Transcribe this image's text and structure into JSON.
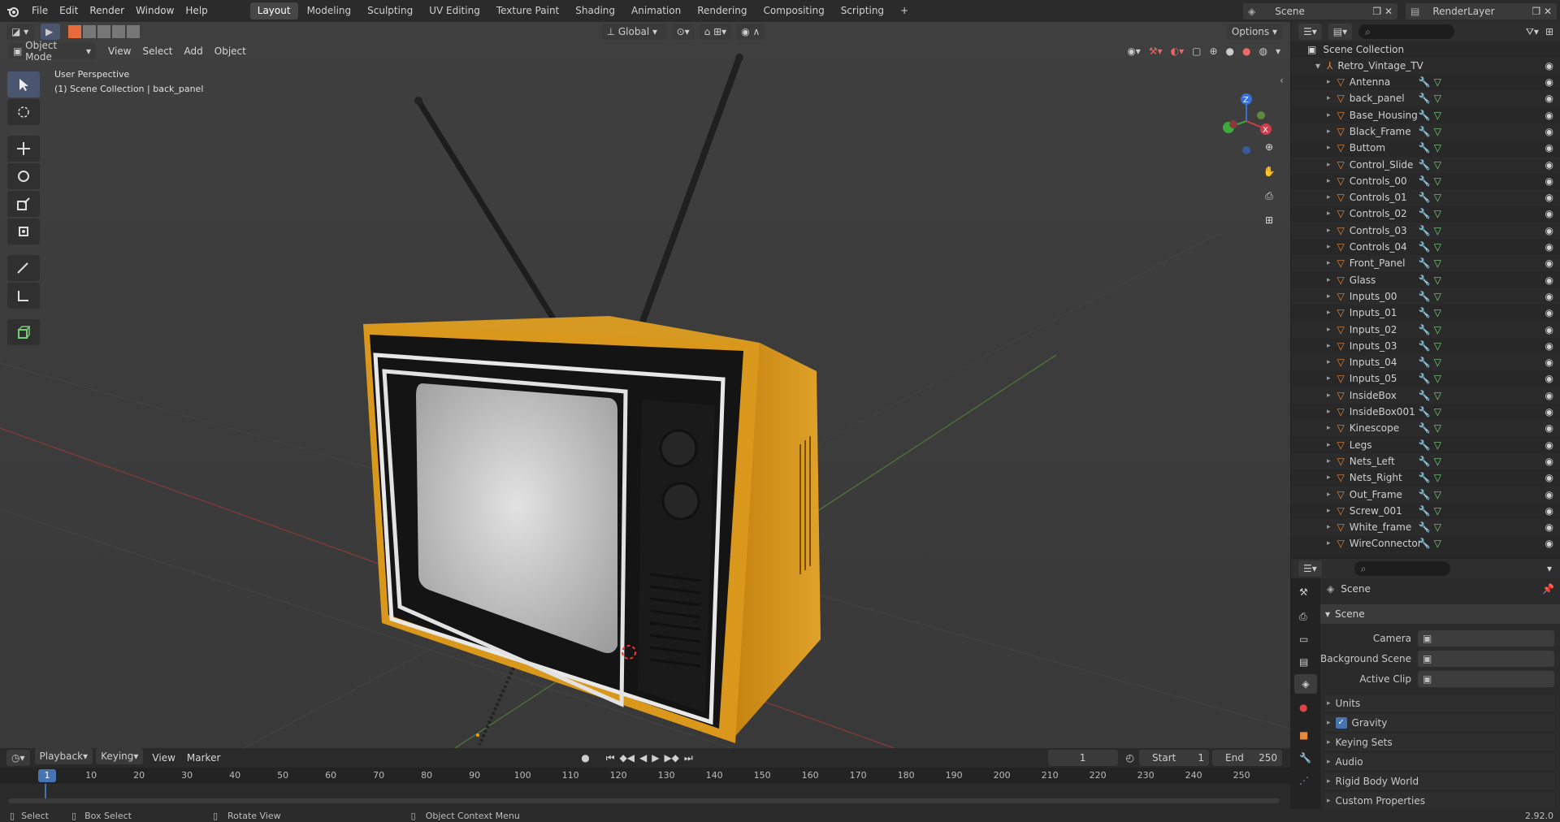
{
  "topbar": {
    "menus": [
      "File",
      "Edit",
      "Render",
      "Window",
      "Help"
    ],
    "workspaces": [
      "Layout",
      "Modeling",
      "Sculpting",
      "UV Editing",
      "Texture Paint",
      "Shading",
      "Animation",
      "Rendering",
      "Compositing",
      "Scripting"
    ],
    "active_workspace": "Layout",
    "add_tab": "+",
    "scene_name": "Scene",
    "render_layer": "RenderLayer"
  },
  "viewport_header": {
    "mode": "Object Mode",
    "menus": [
      "View",
      "Select",
      "Add",
      "Object"
    ],
    "orientation": "Global",
    "options": "Options"
  },
  "viewport": {
    "perspective_label": "User Perspective",
    "collection_label": "(1) Scene Collection | back_panel",
    "gizmo_axes": [
      "Z",
      "Y",
      "X"
    ]
  },
  "outliner": {
    "root": "Scene Collection",
    "collection": "Retro_Vintage_TV",
    "objects": [
      "Antenna",
      "back_panel",
      "Base_Housing",
      "Black_Frame",
      "Buttom",
      "Control_Slide",
      "Controls_00",
      "Controls_01",
      "Controls_02",
      "Controls_03",
      "Controls_04",
      "Front_Panel",
      "Glass",
      "Inputs_00",
      "Inputs_01",
      "Inputs_02",
      "Inputs_03",
      "Inputs_04",
      "Inputs_05",
      "InsideBox",
      "InsideBox001",
      "Kinescope",
      "Legs",
      "Nets_Left",
      "Nets_Right",
      "Out_Frame",
      "Screw_001",
      "White_frame",
      "WireConnector"
    ]
  },
  "properties": {
    "context": "Scene",
    "panel": "Scene",
    "fields": [
      {
        "label": "Camera",
        "value": ""
      },
      {
        "label": "Background Scene",
        "value": ""
      },
      {
        "label": "Active Clip",
        "value": ""
      }
    ],
    "sections": [
      {
        "label": "Units",
        "checkbox": false
      },
      {
        "label": "Gravity",
        "checkbox": true
      },
      {
        "label": "Keying Sets",
        "checkbox": false
      },
      {
        "label": "Audio",
        "checkbox": false
      },
      {
        "label": "Rigid Body World",
        "checkbox": false
      },
      {
        "label": "Custom Properties",
        "checkbox": false
      }
    ]
  },
  "timeline": {
    "menus": [
      "Playback",
      "Keying",
      "View",
      "Marker"
    ],
    "current_frame": "1",
    "start_label": "Start",
    "start": "1",
    "end_label": "End",
    "end": "250",
    "ruler": [
      "1",
      "10",
      "20",
      "30",
      "40",
      "50",
      "60",
      "70",
      "80",
      "90",
      "100",
      "110",
      "120",
      "130",
      "140",
      "150",
      "160",
      "170",
      "180",
      "190",
      "200",
      "210",
      "220",
      "230",
      "240",
      "250"
    ]
  },
  "statusbar": {
    "items": [
      "Select",
      "Box Select",
      "Rotate View",
      "Object Context Menu"
    ],
    "version": "2.92.0"
  },
  "colors": {
    "accent": "#4772b3",
    "tv_orange": "#d99a1f",
    "object_icon": "#e8873a",
    "active_tool": "#4a5670"
  }
}
